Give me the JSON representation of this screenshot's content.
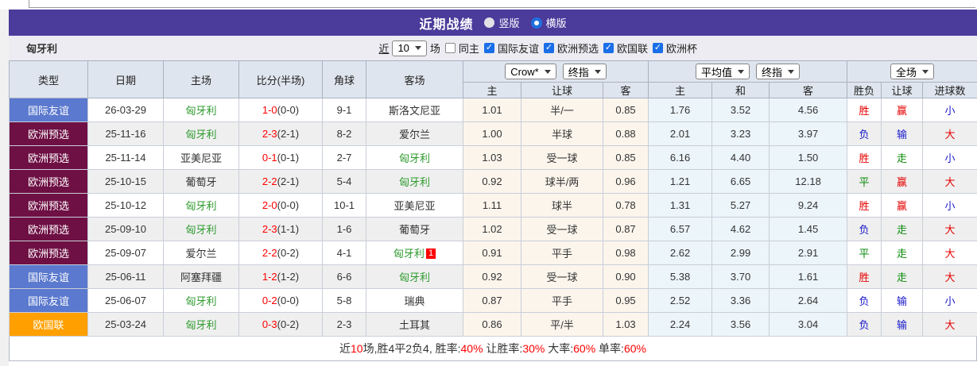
{
  "colors": {
    "r": "#e60000",
    "g": "#0a8a0a",
    "b": "#1919cc",
    "badges": {
      "friendly": "#5b79ce",
      "qualifier": "#6e1044",
      "nations": "#ffa000"
    }
  },
  "title_bar": {
    "title": "近期战绩",
    "vertical_label": "竖版",
    "horizontal_label": "横版"
  },
  "filter_bar": {
    "team": "匈牙利",
    "near": "近",
    "count": "10",
    "matches": "场",
    "same_home": "同主",
    "leagues": [
      "国际友谊",
      "欧洲预选",
      "欧国联",
      "欧洲杯"
    ]
  },
  "table": {
    "left_headers": [
      "类型",
      "日期",
      "主场",
      "比分(半场)",
      "角球",
      "客场"
    ],
    "controls": {
      "crown": [
        "Crow*",
        "终指"
      ],
      "europe": [
        "平均值",
        "终指"
      ],
      "result": [
        "全场"
      ]
    },
    "sub_headers": [
      "主",
      "让球",
      "客",
      "主",
      "和",
      "客",
      "胜负",
      "让球",
      "进球数"
    ],
    "rows": [
      {
        "type": "国际友谊",
        "type_key": "friendly",
        "date": "26-03-29",
        "home": "匈牙利",
        "home_hl": true,
        "score": "1-0",
        "half": "(0-0)",
        "corner": "9-1",
        "away": "斯洛文尼亚",
        "away_hl": false,
        "away_card": "",
        "crown": [
          "1.01",
          "半/一",
          "0.85"
        ],
        "avg": [
          "1.76",
          "3.52",
          "4.56"
        ],
        "wdl": [
          "胜",
          "r"
        ],
        "hc": [
          "赢",
          "r"
        ],
        "ou": [
          "小",
          "b"
        ]
      },
      {
        "type": "欧洲预选",
        "type_key": "qualifier",
        "date": "25-11-16",
        "home": "匈牙利",
        "home_hl": true,
        "score": "2-3",
        "half": "(2-1)",
        "corner": "8-2",
        "away": "爱尔兰",
        "away_hl": false,
        "away_card": "",
        "crown": [
          "1.00",
          "半球",
          "0.88"
        ],
        "avg": [
          "2.01",
          "3.23",
          "3.97"
        ],
        "wdl": [
          "负",
          "b"
        ],
        "hc": [
          "输",
          "b"
        ],
        "ou": [
          "大",
          "r"
        ]
      },
      {
        "type": "欧洲预选",
        "type_key": "qualifier",
        "date": "25-11-14",
        "home": "亚美尼亚",
        "home_hl": false,
        "score": "0-1",
        "half": "(0-1)",
        "corner": "2-7",
        "away": "匈牙利",
        "away_hl": true,
        "away_card": "",
        "crown": [
          "1.03",
          "受一球",
          "0.85"
        ],
        "avg": [
          "6.16",
          "4.40",
          "1.50"
        ],
        "wdl": [
          "胜",
          "r"
        ],
        "hc": [
          "走",
          "g"
        ],
        "ou": [
          "小",
          "b"
        ]
      },
      {
        "type": "欧洲预选",
        "type_key": "qualifier",
        "date": "25-10-15",
        "home": "葡萄牙",
        "home_hl": false,
        "score": "2-2",
        "half": "(2-1)",
        "corner": "5-4",
        "away": "匈牙利",
        "away_hl": true,
        "away_card": "",
        "crown": [
          "0.92",
          "球半/两",
          "0.96"
        ],
        "avg": [
          "1.21",
          "6.65",
          "12.18"
        ],
        "wdl": [
          "平",
          "g"
        ],
        "hc": [
          "赢",
          "r"
        ],
        "ou": [
          "大",
          "r"
        ]
      },
      {
        "type": "欧洲预选",
        "type_key": "qualifier",
        "date": "25-10-12",
        "home": "匈牙利",
        "home_hl": true,
        "score": "2-0",
        "half": "(0-0)",
        "corner": "10-1",
        "away": "亚美尼亚",
        "away_hl": false,
        "away_card": "",
        "crown": [
          "1.11",
          "球半",
          "0.78"
        ],
        "avg": [
          "1.31",
          "5.27",
          "9.24"
        ],
        "wdl": [
          "胜",
          "r"
        ],
        "hc": [
          "赢",
          "r"
        ],
        "ou": [
          "小",
          "b"
        ]
      },
      {
        "type": "欧洲预选",
        "type_key": "qualifier",
        "date": "25-09-10",
        "home": "匈牙利",
        "home_hl": true,
        "score": "2-3",
        "half": "(1-1)",
        "corner": "1-6",
        "away": "葡萄牙",
        "away_hl": false,
        "away_card": "",
        "crown": [
          "1.02",
          "受一球",
          "0.87"
        ],
        "avg": [
          "6.57",
          "4.62",
          "1.45"
        ],
        "wdl": [
          "负",
          "b"
        ],
        "hc": [
          "走",
          "g"
        ],
        "ou": [
          "大",
          "r"
        ]
      },
      {
        "type": "欧洲预选",
        "type_key": "qualifier",
        "date": "25-09-07",
        "home": "爱尔兰",
        "home_hl": false,
        "score": "2-2",
        "half": "(0-2)",
        "corner": "4-1",
        "away": "匈牙利",
        "away_hl": true,
        "away_card": "1",
        "crown": [
          "0.91",
          "平手",
          "0.98"
        ],
        "avg": [
          "2.62",
          "2.99",
          "2.91"
        ],
        "wdl": [
          "平",
          "g"
        ],
        "hc": [
          "走",
          "g"
        ],
        "ou": [
          "大",
          "r"
        ]
      },
      {
        "type": "国际友谊",
        "type_key": "friendly",
        "date": "25-06-11",
        "home": "阿塞拜疆",
        "home_hl": false,
        "score": "1-2",
        "half": "(1-2)",
        "corner": "6-6",
        "away": "匈牙利",
        "away_hl": true,
        "away_card": "",
        "crown": [
          "0.92",
          "受一球",
          "0.90"
        ],
        "avg": [
          "5.38",
          "3.70",
          "1.61"
        ],
        "wdl": [
          "胜",
          "r"
        ],
        "hc": [
          "走",
          "g"
        ],
        "ou": [
          "大",
          "r"
        ]
      },
      {
        "type": "国际友谊",
        "type_key": "friendly",
        "date": "25-06-07",
        "home": "匈牙利",
        "home_hl": true,
        "score": "0-2",
        "half": "(0-0)",
        "corner": "5-8",
        "away": "瑞典",
        "away_hl": false,
        "away_card": "",
        "crown": [
          "0.87",
          "平手",
          "0.95"
        ],
        "avg": [
          "2.52",
          "3.36",
          "2.64"
        ],
        "wdl": [
          "负",
          "b"
        ],
        "hc": [
          "输",
          "b"
        ],
        "ou": [
          "小",
          "b"
        ]
      },
      {
        "type": "欧国联",
        "type_key": "nations",
        "date": "25-03-24",
        "home": "匈牙利",
        "home_hl": true,
        "score": "0-3",
        "half": "(0-2)",
        "corner": "2-3",
        "away": "土耳其",
        "away_hl": false,
        "away_card": "",
        "crown": [
          "0.86",
          "平/半",
          "1.03"
        ],
        "avg": [
          "2.24",
          "3.56",
          "3.04"
        ],
        "wdl": [
          "负",
          "b"
        ],
        "hc": [
          "输",
          "b"
        ],
        "ou": [
          "大",
          "r"
        ]
      }
    ]
  },
  "footer": {
    "segments": [
      [
        "近",
        "d"
      ],
      [
        "10",
        "r"
      ],
      [
        "场,胜4平2负4, 胜率:",
        "d"
      ],
      [
        "40%",
        "r"
      ],
      [
        " 让胜率:",
        "d"
      ],
      [
        "30%",
        "r"
      ],
      [
        " 大率:",
        "d"
      ],
      [
        "60%",
        "r"
      ],
      [
        " 单率:",
        "d"
      ],
      [
        "60%",
        "r"
      ]
    ]
  }
}
